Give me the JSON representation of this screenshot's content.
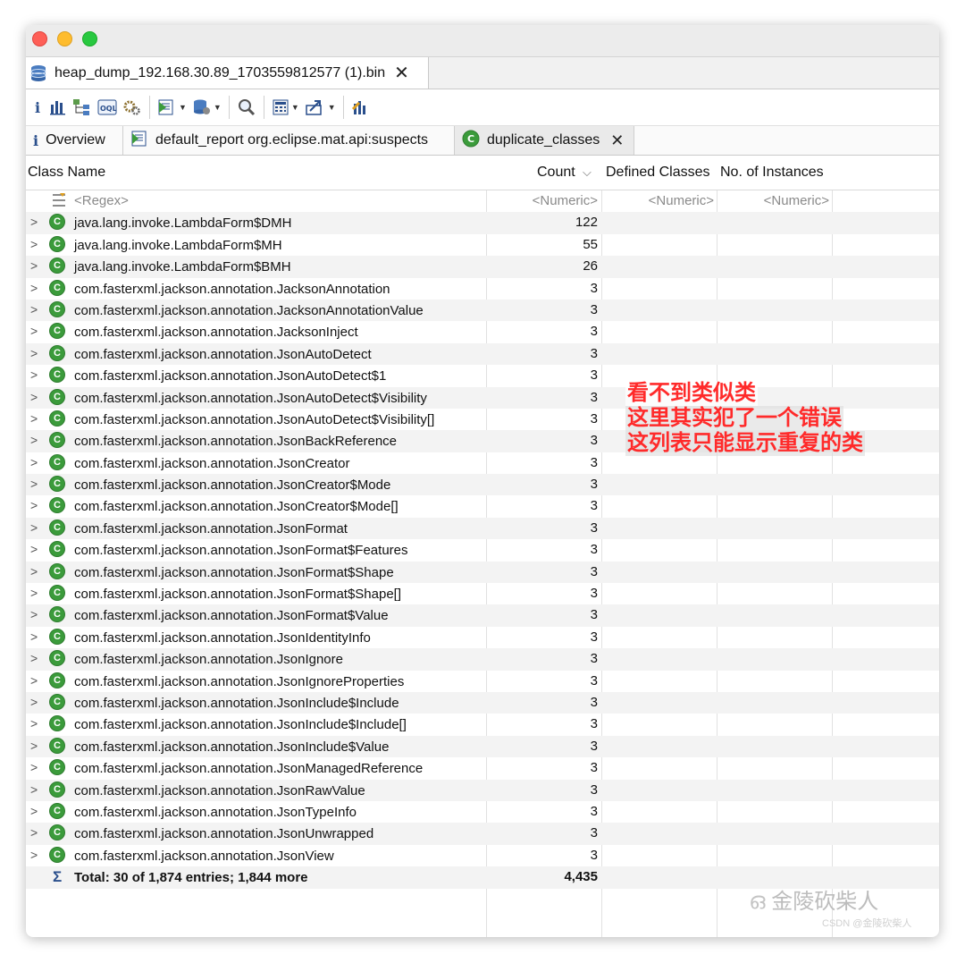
{
  "editor_tab": {
    "title": "heap_dump_192.168.30.89_1703559812577 (1).bin",
    "close": "✕"
  },
  "toolbar": {
    "info": "i"
  },
  "view_tabs": [
    {
      "label": "Overview"
    },
    {
      "label": "default_report org.eclipse.mat.api:suspects"
    },
    {
      "label": "duplicate_classes",
      "close": "✕"
    }
  ],
  "columns": {
    "class_name": "Class Name",
    "count": "Count",
    "count_sort": "⌵",
    "defined": "Defined Classes",
    "instances": "No. of Instances"
  },
  "filter_row": {
    "regex": "<Regex>",
    "numeric1": "<Numeric>",
    "numeric2": "<Numeric>",
    "numeric3": "<Numeric>"
  },
  "rows": [
    {
      "name": "java.lang.invoke.LambdaForm$DMH",
      "count": "122"
    },
    {
      "name": "java.lang.invoke.LambdaForm$MH",
      "count": "55"
    },
    {
      "name": "java.lang.invoke.LambdaForm$BMH",
      "count": "26"
    },
    {
      "name": "com.fasterxml.jackson.annotation.JacksonAnnotation",
      "count": "3"
    },
    {
      "name": "com.fasterxml.jackson.annotation.JacksonAnnotationValue",
      "count": "3"
    },
    {
      "name": "com.fasterxml.jackson.annotation.JacksonInject",
      "count": "3"
    },
    {
      "name": "com.fasterxml.jackson.annotation.JsonAutoDetect",
      "count": "3"
    },
    {
      "name": "com.fasterxml.jackson.annotation.JsonAutoDetect$1",
      "count": "3"
    },
    {
      "name": "com.fasterxml.jackson.annotation.JsonAutoDetect$Visibility",
      "count": "3"
    },
    {
      "name": "com.fasterxml.jackson.annotation.JsonAutoDetect$Visibility[]",
      "count": "3"
    },
    {
      "name": "com.fasterxml.jackson.annotation.JsonBackReference",
      "count": "3"
    },
    {
      "name": "com.fasterxml.jackson.annotation.JsonCreator",
      "count": "3"
    },
    {
      "name": "com.fasterxml.jackson.annotation.JsonCreator$Mode",
      "count": "3"
    },
    {
      "name": "com.fasterxml.jackson.annotation.JsonCreator$Mode[]",
      "count": "3"
    },
    {
      "name": "com.fasterxml.jackson.annotation.JsonFormat",
      "count": "3"
    },
    {
      "name": "com.fasterxml.jackson.annotation.JsonFormat$Features",
      "count": "3"
    },
    {
      "name": "com.fasterxml.jackson.annotation.JsonFormat$Shape",
      "count": "3"
    },
    {
      "name": "com.fasterxml.jackson.annotation.JsonFormat$Shape[]",
      "count": "3"
    },
    {
      "name": "com.fasterxml.jackson.annotation.JsonFormat$Value",
      "count": "3"
    },
    {
      "name": "com.fasterxml.jackson.annotation.JsonIdentityInfo",
      "count": "3"
    },
    {
      "name": "com.fasterxml.jackson.annotation.JsonIgnore",
      "count": "3"
    },
    {
      "name": "com.fasterxml.jackson.annotation.JsonIgnoreProperties",
      "count": "3"
    },
    {
      "name": "com.fasterxml.jackson.annotation.JsonInclude$Include",
      "count": "3"
    },
    {
      "name": "com.fasterxml.jackson.annotation.JsonInclude$Include[]",
      "count": "3"
    },
    {
      "name": "com.fasterxml.jackson.annotation.JsonInclude$Value",
      "count": "3"
    },
    {
      "name": "com.fasterxml.jackson.annotation.JsonManagedReference",
      "count": "3"
    },
    {
      "name": "com.fasterxml.jackson.annotation.JsonRawValue",
      "count": "3"
    },
    {
      "name": "com.fasterxml.jackson.annotation.JsonTypeInfo",
      "count": "3"
    },
    {
      "name": "com.fasterxml.jackson.annotation.JsonUnwrapped",
      "count": "3"
    },
    {
      "name": "com.fasterxml.jackson.annotation.JsonView",
      "count": "3"
    }
  ],
  "total": {
    "label": "Total: 30 of 1,874 entries; 1,844 more",
    "count": "4,435"
  },
  "annotation": {
    "line1": "看不到类似类",
    "line2": "这里其实犯了一个错误",
    "line3": "这列表只能显示重复的类"
  },
  "watermark": {
    "main": "金陵砍柴人",
    "sub": "CSDN @金陵砍柴人"
  },
  "colors": {
    "class_icon": "#3b9b3b",
    "annotation": "#ff2a2a"
  }
}
